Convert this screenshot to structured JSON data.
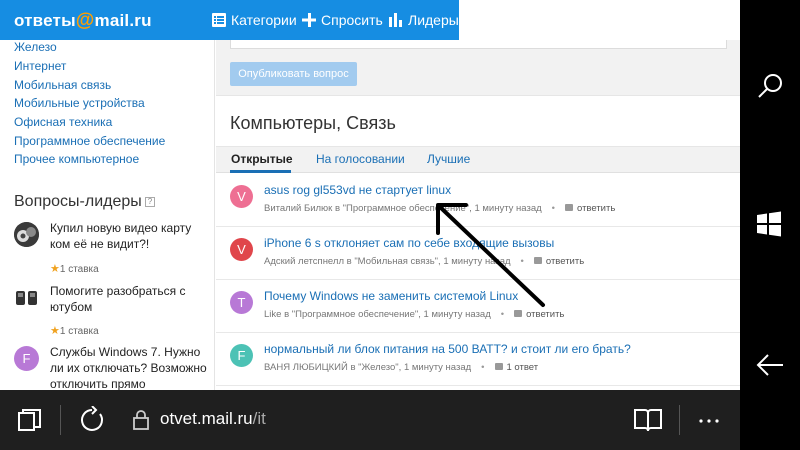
{
  "header": {
    "logo_prefix": "ответы",
    "logo_at": "@",
    "logo_suffix": "mail.ru",
    "nav": [
      {
        "label": "Категории",
        "icon": "list-icon"
      },
      {
        "label": "Спросить",
        "icon": "plus-icon"
      },
      {
        "label": "Лидеры",
        "icon": "bar-chart-icon"
      }
    ]
  },
  "sidebar": {
    "categories": [
      "Железо",
      "Интернет",
      "Мобильная связь",
      "Мобильные устройства",
      "Офисная техника",
      "Программное обеспечение",
      "Прочее компьютерное"
    ],
    "leaders_title": "Вопросы-лидеры",
    "leaders": [
      {
        "text": "Купил новую видео карту ком её не видит?!",
        "badge": "1 ставка"
      },
      {
        "text": "Помогите разобраться с ютубом",
        "badge": "1 ставка"
      },
      {
        "text": "Службы Windows 7. Нужно ли их отключать? Возможно отключить прямо",
        "badge": ""
      }
    ]
  },
  "main": {
    "publish_button": "Опубликовать вопрос",
    "section_title": "Компьютеры, Связь",
    "tabs": [
      "Открытые",
      "На голосовании",
      "Лучшие"
    ],
    "questions": [
      {
        "avatar_letter": "V",
        "avatar_color": "#ee6f93",
        "title": "asus rog gl553vd не стартует linux",
        "meta": "Виталий Билюк в \"Программное обеспечение\", 1 минуту назад",
        "action": "ответить"
      },
      {
        "avatar_letter": "V",
        "avatar_color": "#e0464b",
        "title": "iPhone 6 s отклоняет сам по себе входящие вызовы",
        "meta": "Адский летспнелл в \"Мобильная связь\", 1 минуту назад",
        "action": "ответить"
      },
      {
        "avatar_letter": "T",
        "avatar_color": "#b879d6",
        "title": "Почему Windows не заменить системой Linux",
        "meta": "Like в \"Программное обеспечение\", 1 минуту назад",
        "action": "ответить"
      },
      {
        "avatar_letter": "F",
        "avatar_color": "#4cc2b5",
        "title": "нормальный ли блок питания на 500 ВАТТ? и стоит ли его брать?",
        "meta": "ВАНЯ ЛЮБИЦКИЙ в \"Железо\", 1 минуту назад",
        "action": "1 ответ"
      }
    ]
  },
  "browser": {
    "url_host": "otvet.mail.ru",
    "url_path": "/it"
  },
  "colors": {
    "header_blue": "#168de2",
    "link_blue": "#1a6fb5",
    "logo_at_orange": "#ff9e00"
  }
}
